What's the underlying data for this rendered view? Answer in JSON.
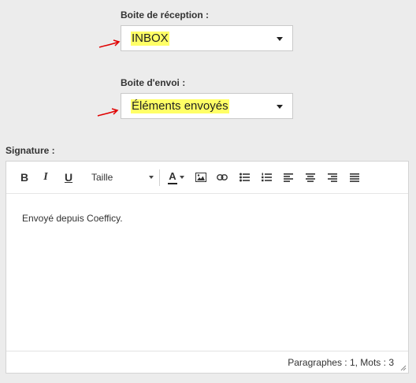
{
  "inbox": {
    "label": "Boite de réception :",
    "value": "INBOX"
  },
  "outbox": {
    "label": "Boite d'envoi :",
    "value": "Éléments envoyés"
  },
  "signature": {
    "label": "Signature :",
    "toolbar": {
      "bold": "B",
      "italic": "I",
      "underline": "U",
      "font_size_label": "Taille",
      "text_color": "A"
    },
    "content": "Envoyé depuis Coefficy.",
    "status": "Paragraphes : 1, Mots : 3"
  },
  "colors": {
    "highlight": "#ffff66",
    "annotation_arrow": "#e00000"
  },
  "icons": [
    "bold-icon",
    "italic-icon",
    "underline-icon",
    "font-size-select",
    "text-color-icon",
    "image-icon",
    "link-icon",
    "bulleted-list-icon",
    "numbered-list-icon",
    "align-left-icon",
    "align-center-icon",
    "align-right-icon",
    "justify-icon",
    "resize-handle-icon"
  ]
}
